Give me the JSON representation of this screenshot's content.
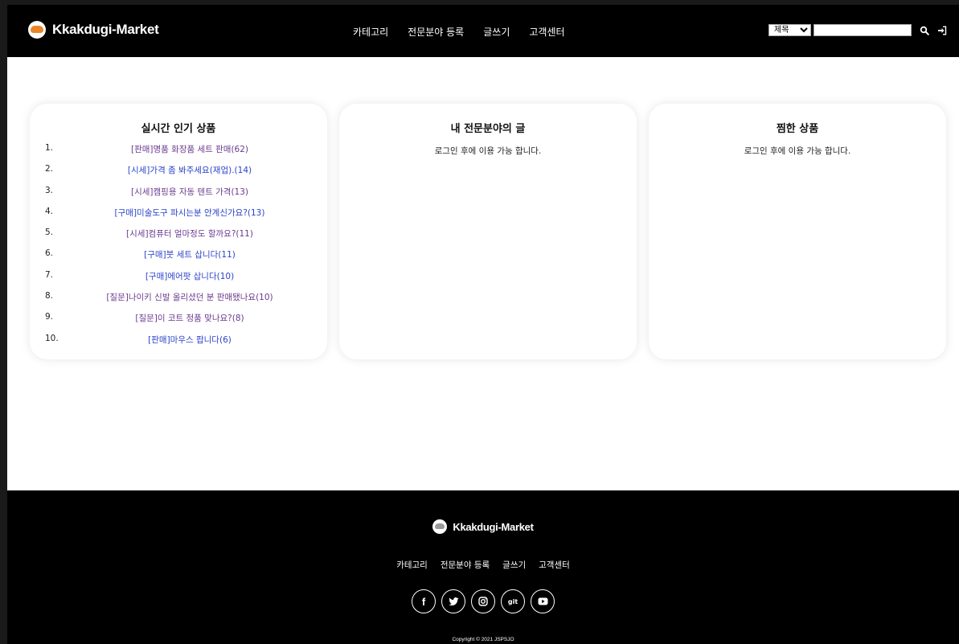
{
  "header": {
    "brand": "Kkakdugi-Market",
    "nav": [
      "카테고리",
      "전문분야 등록",
      "글쓰기",
      "고객센터"
    ],
    "search": {
      "select_value": "제목",
      "select_options": [
        "제목"
      ],
      "input_value": "",
      "search_icon": "search-icon",
      "login_icon": "sign-in-icon"
    }
  },
  "cards": {
    "popular": {
      "title": "실시간 인기 상품",
      "items": [
        {
          "rank": "1.",
          "text": "[판매]명품 화장품 세트 판매(62)"
        },
        {
          "rank": "2.",
          "text": "[시세]가격 좀 봐주세요(재업).(14)"
        },
        {
          "rank": "3.",
          "text": "[시세]캠핑용 자동 텐트 가격(13)"
        },
        {
          "rank": "4.",
          "text": "[구매]미술도구 파시는분 안계신가요?(13)"
        },
        {
          "rank": "5.",
          "text": "[시세]컴퓨터 얼마정도 할까요?(11)"
        },
        {
          "rank": "6.",
          "text": "[구매]붓 세트 삽니다(11)"
        },
        {
          "rank": "7.",
          "text": "[구매]에어팟 삽니다(10)"
        },
        {
          "rank": "8.",
          "text": "[질문]나이키 신발 올리셨던 분 판매됐나요(10)"
        },
        {
          "rank": "9.",
          "text": "[질문]이 코트 정품 맞나요?(8)"
        },
        {
          "rank": "10.",
          "text": "[판매]마우스 팝니다(6)"
        }
      ]
    },
    "expertise": {
      "title": "내 전문분야의 글",
      "message": "로그인 후에 이용 가능 합니다."
    },
    "wishlist": {
      "title": "찜한 상품",
      "message": "로그인 후에 이용 가능 합니다."
    }
  },
  "footer": {
    "brand": "Kkakdugi-Market",
    "nav": [
      "카테고리",
      "전문분야 등록",
      "글쓰기",
      "고객센터"
    ],
    "social": [
      {
        "icon": "facebook-icon",
        "label": "f"
      },
      {
        "icon": "twitter-icon",
        "label": ""
      },
      {
        "icon": "instagram-icon",
        "label": ""
      },
      {
        "icon": "git-icon",
        "label": "git"
      },
      {
        "icon": "youtube-icon",
        "label": ""
      }
    ],
    "copyright": "Copyright © 2021 JSPSJO"
  },
  "colors": {
    "header_bg": "#000000",
    "link": "#2b43c9",
    "visited_link": "#6a3a8f",
    "logo_accent": "#e8862a"
  }
}
